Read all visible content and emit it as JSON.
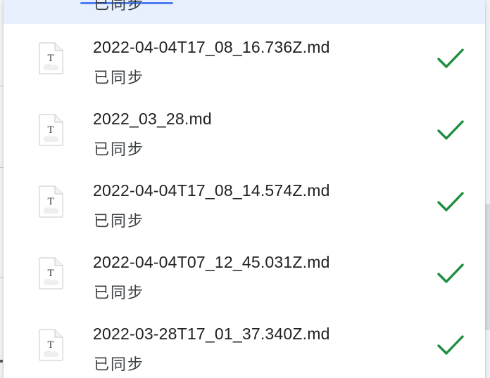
{
  "top_partial": {
    "status": "已同步"
  },
  "files": [
    {
      "name": "2022-04-04T17_08_16.736Z.md",
      "status": "已同步",
      "icon": "text-file-icon",
      "sync_icon": "check-icon"
    },
    {
      "name": "2022_03_28.md",
      "status": "已同步",
      "icon": "text-file-icon",
      "sync_icon": "check-icon"
    },
    {
      "name": "2022-04-04T17_08_14.574Z.md",
      "status": "已同步",
      "icon": "text-file-icon",
      "sync_icon": "check-icon"
    },
    {
      "name": "2022-04-04T07_12_45.031Z.md",
      "status": "已同步",
      "icon": "text-file-icon",
      "sync_icon": "check-icon"
    },
    {
      "name": "2022-03-28T17_01_37.340Z.md",
      "status": "已同步",
      "icon": "text-file-icon",
      "sync_icon": "check-icon"
    }
  ],
  "file_icon_letter": "T",
  "colors": {
    "check": "#1e8e3e",
    "selected_row": "#e8f0fe",
    "accent": "#4f7ef0",
    "text_primary": "#202124",
    "text_secondary": "#3c4043"
  }
}
